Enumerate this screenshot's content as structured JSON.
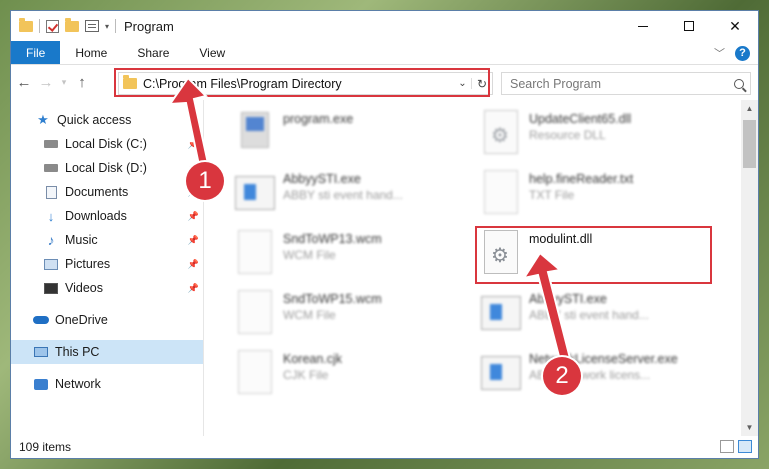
{
  "window": {
    "title": "Program"
  },
  "ribbon": {
    "tabs": [
      "File",
      "Home",
      "Share",
      "View"
    ],
    "help": "?"
  },
  "address": {
    "path": "C:\\Program Files\\Program Directory",
    "search_placeholder": "Search Program"
  },
  "nav_pane": {
    "items": [
      {
        "label": "Quick access",
        "icon": "star-icon"
      },
      {
        "label": "Local Disk (C:)",
        "icon": "drive-icon",
        "pinned": true
      },
      {
        "label": "Local Disk (D:)",
        "icon": "drive-icon",
        "pinned": true
      },
      {
        "label": "Documents",
        "icon": "documents-icon",
        "pinned": true
      },
      {
        "label": "Downloads",
        "icon": "download-icon",
        "pinned": true
      },
      {
        "label": "Music",
        "icon": "music-icon",
        "pinned": true
      },
      {
        "label": "Pictures",
        "icon": "pictures-icon",
        "pinned": true
      },
      {
        "label": "Videos",
        "icon": "videos-icon",
        "pinned": true
      },
      {
        "label": "OneDrive",
        "icon": "cloud-icon"
      },
      {
        "label": "This PC",
        "icon": "computer-icon",
        "selected": true
      },
      {
        "label": "Network",
        "icon": "network-icon"
      }
    ]
  },
  "files": [
    {
      "name": "program.exe",
      "desc": "",
      "icon": "setup-icon"
    },
    {
      "name": "UpdateClient65.dll",
      "desc": "Resource DLL",
      "icon": "dll-icon"
    },
    {
      "name": "AbbyySTI.exe",
      "desc": "ABBY sti event hand...",
      "icon": "exe-icon"
    },
    {
      "name": "help.fineReader.txt",
      "desc": "TXT File",
      "icon": "text-file-icon"
    },
    {
      "name": "SndToWP13.wcm",
      "desc": "WCM File",
      "icon": "file-icon"
    },
    {
      "name": "modulint.dll",
      "desc": "",
      "icon": "dll-icon"
    },
    {
      "name": "SndToWP15.wcm",
      "desc": "WCM File",
      "icon": "file-icon"
    },
    {
      "name": "AbbyySTI.exe",
      "desc": "ABBY sti event hand...",
      "icon": "exe-icon"
    },
    {
      "name": "Korean.cjk",
      "desc": "CJK File",
      "icon": "file-icon"
    },
    {
      "name": "NetworkLicenseServer.exe",
      "desc": "ABBY network licens...",
      "icon": "exe-icon"
    }
  ],
  "status": {
    "item_count": "109 items"
  },
  "annotations": {
    "step1": "1",
    "step2": "2",
    "color": "#d9363e"
  }
}
